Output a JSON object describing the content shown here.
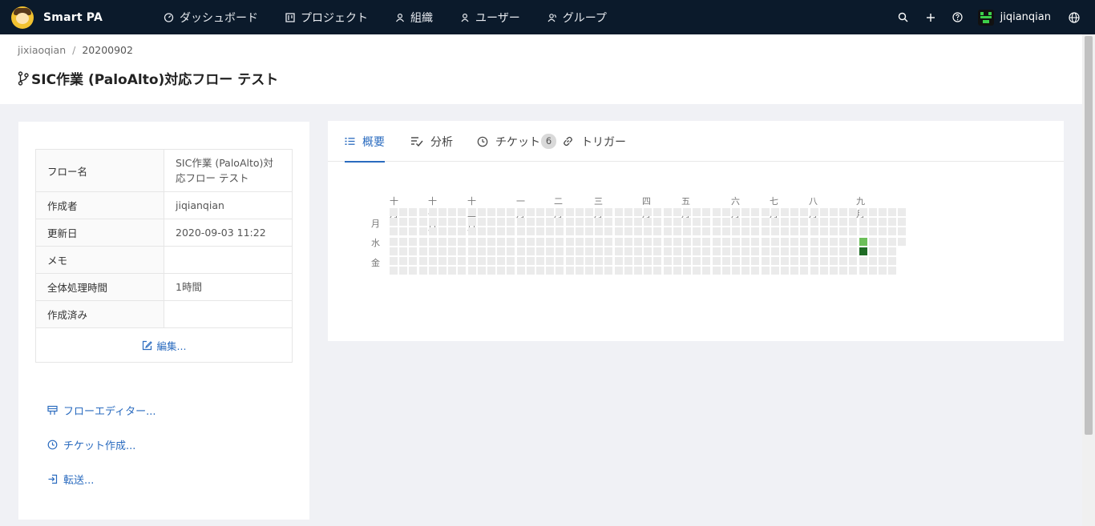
{
  "app": {
    "name": "Smart PA"
  },
  "nav": [
    {
      "label": "ダッシュボード",
      "icon": "dashboard-icon"
    },
    {
      "label": "プロジェクト",
      "icon": "project-icon"
    },
    {
      "label": "組織",
      "icon": "organization-icon"
    },
    {
      "label": "ユーザー",
      "icon": "user-icon"
    },
    {
      "label": "グループ",
      "icon": "group-icon"
    }
  ],
  "toolbar": {
    "user_name": "jiqianqian"
  },
  "breadcrumb": {
    "owner": "jixiaoqian",
    "separator": "/",
    "project": "20200902"
  },
  "page": {
    "title": "SIC作業 (PaloAlto)対応フロー テスト"
  },
  "info": {
    "rows": [
      {
        "key": "フロー名",
        "value": "SIC作業 (PaloAlto)対応フロー テスト"
      },
      {
        "key": "作成者",
        "value": "jiqianqian"
      },
      {
        "key": "更新日",
        "value": "2020-09-03 11:22"
      },
      {
        "key": "メモ",
        "value": ""
      },
      {
        "key": "全体処理時間",
        "value": "1時間"
      },
      {
        "key": "作成済み",
        "value": ""
      }
    ],
    "edit_label": "編集..."
  },
  "actions": [
    {
      "label": "フローエディター...",
      "icon": "flow-editor-icon"
    },
    {
      "label": "チケット作成...",
      "icon": "ticket-create-icon"
    },
    {
      "label": "転送...",
      "icon": "transfer-icon"
    }
  ],
  "tabs": [
    {
      "label": "概要",
      "icon": "list-icon",
      "active": true
    },
    {
      "label": "分析",
      "icon": "analysis-icon"
    },
    {
      "label": "チケット",
      "icon": "ticket-icon",
      "badge": "6"
    },
    {
      "label": "トリガー",
      "icon": "link-icon"
    }
  ],
  "heatmap": {
    "months": [
      "十月",
      "十一月",
      "十二月",
      "一月",
      "二月",
      "三月",
      "四月",
      "五月",
      "六月",
      "七月",
      "八月",
      "九月"
    ],
    "weekdays": [
      "月",
      "水",
      "金"
    ],
    "weeks": 53,
    "activity": [
      {
        "week": 48,
        "day": 3,
        "level": 1
      },
      {
        "week": 48,
        "day": 4,
        "level": 2
      }
    ]
  },
  "colors": {
    "topbar": "#0b1a2b",
    "accent": "#2a6bbf",
    "heat_empty": "#ebebeb",
    "heat_low": "#6cbf59",
    "heat_high": "#1e6b24"
  }
}
